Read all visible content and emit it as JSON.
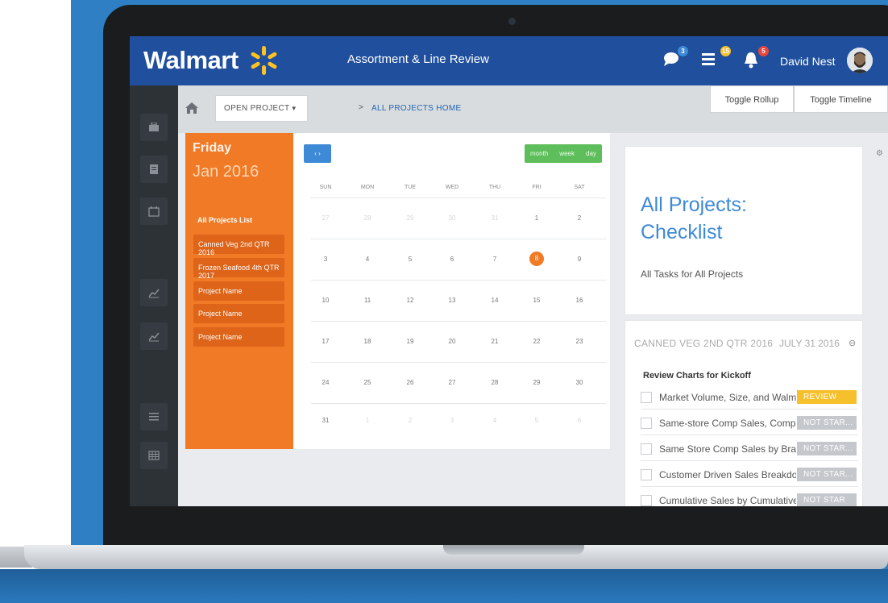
{
  "header": {
    "brand": "Walmart",
    "app_title": "Assortment & Line Review",
    "chat_badge": "3",
    "list_badge": "15",
    "bell_badge": "5",
    "user_name": "David Nest"
  },
  "breadcrumb": {
    "open_project_label": "OPEN PROJECT",
    "separator": ">",
    "link_label": "ALL PROJECTS HOME",
    "toggle_rollup": "Toggle Rollup",
    "toggle_timeline": "Toggle Timeline"
  },
  "date_panel": {
    "day_name": "Friday",
    "month_year": "Jan 2016",
    "list_title": "All Projects List",
    "projects": [
      "Canned Veg 2nd QTR 2016",
      "Frozen Seafood 4th QTR 2017",
      "Project Name",
      "Project Name",
      "Project Name"
    ]
  },
  "calendar": {
    "nav_label": "‹ ›",
    "views": [
      "month",
      "week",
      "day"
    ],
    "days_of_week": [
      "SUN",
      "MON",
      "TUE",
      "WED",
      "THU",
      "FRI",
      "SAT"
    ],
    "weeks": [
      [
        "27",
        "28",
        "29",
        "30",
        "31",
        "1",
        "2"
      ],
      [
        "3",
        "4",
        "5",
        "6",
        "7",
        "8",
        "9"
      ],
      [
        "10",
        "11",
        "12",
        "13",
        "14",
        "15",
        "16"
      ],
      [
        "17",
        "18",
        "19",
        "20",
        "21",
        "22",
        "23"
      ],
      [
        "24",
        "25",
        "26",
        "27",
        "28",
        "29",
        "30"
      ],
      [
        "31",
        "1",
        "2",
        "3",
        "4",
        "5",
        "6"
      ]
    ],
    "today": "8"
  },
  "checklist": {
    "title_line1": "All Projects:",
    "title_line2": "Checklist",
    "subtitle": "All Tasks for All Projects",
    "project_name": "CANNED VEG 2ND QTR 2016",
    "project_date": "JULY 31 2016",
    "task_group": "Review Charts for Kickoff",
    "tasks": [
      {
        "label": "Market Volume, Size, and Walmart",
        "status": "REVIEW"
      },
      {
        "label": "Same-store Comp Sales, Comp",
        "status": "NOT STAR..."
      },
      {
        "label": "Same Store Comp Sales by Brand",
        "status": "NOT STAR..."
      },
      {
        "label": "Customer Driven Sales Breakdown",
        "status": "NOT STAR..."
      },
      {
        "label": "Cumulative Sales by Cumulative",
        "status": "NOT STAR"
      }
    ]
  },
  "colors": {
    "header_blue": "#1f4f9d",
    "accent_orange": "#f07a26",
    "review_yellow": "#f5c02c",
    "not_started_gray": "#c4c7cb",
    "link_blue": "#3e8ad6",
    "view_green": "#5fbe5c"
  }
}
